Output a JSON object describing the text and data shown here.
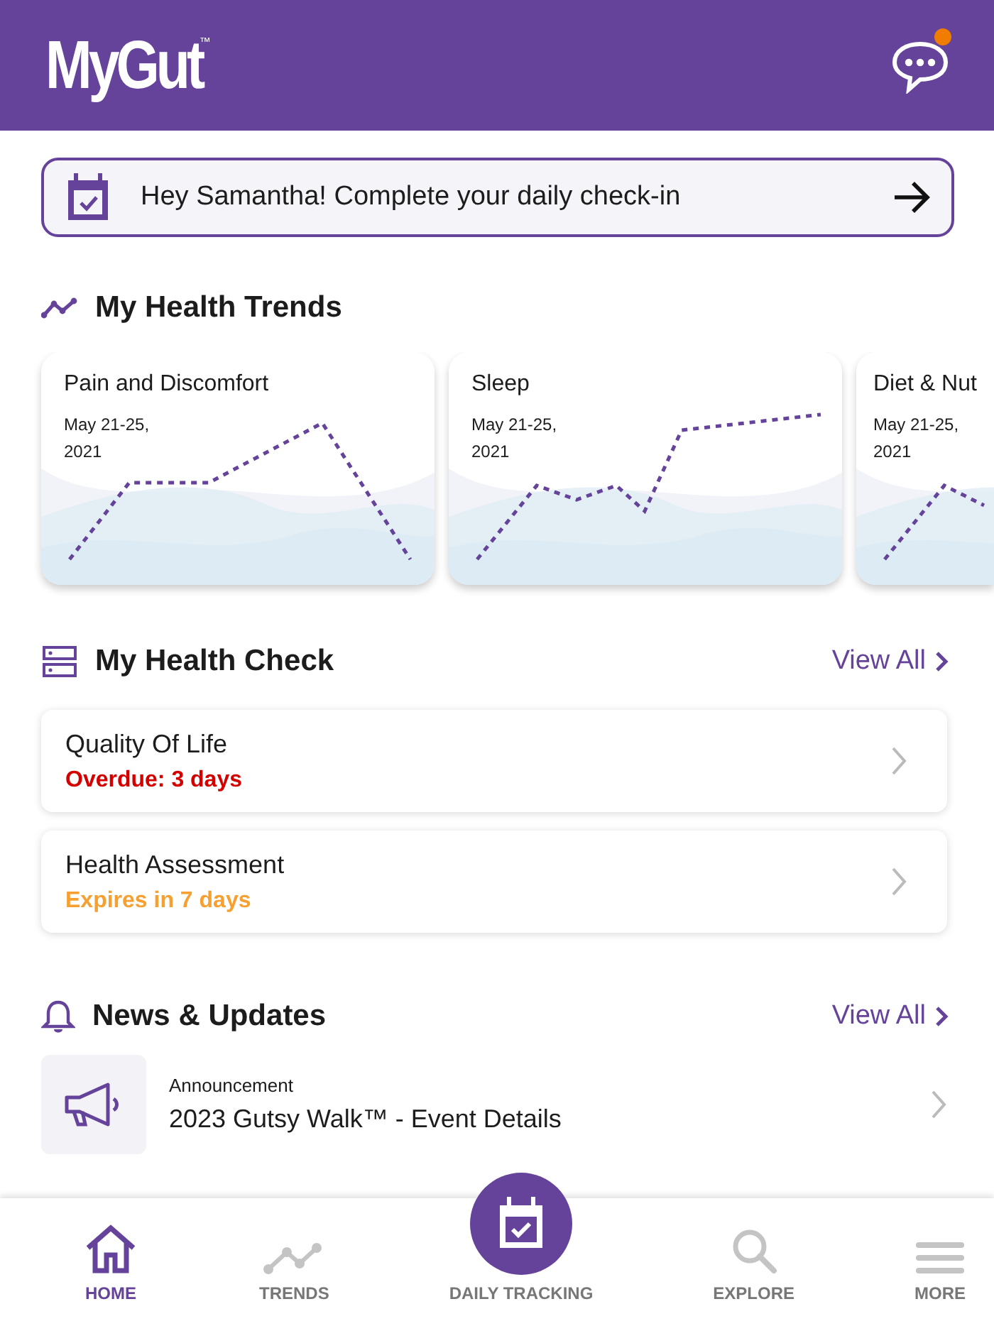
{
  "header": {
    "logo": "MyGut",
    "trademark": "™",
    "has_unread": true
  },
  "checkin_banner": {
    "text": "Hey Samantha! Complete your daily check-in"
  },
  "health_trends": {
    "title": "My Health Trends",
    "cards": [
      {
        "title": "Pain and Discomfort",
        "date_line_1": "May 21-25,",
        "date_line_2": "2021"
      },
      {
        "title": "Sleep",
        "date_line_1": "May 21-25,",
        "date_line_2": "2021"
      },
      {
        "title": "Diet & Nut",
        "date_line_1": "May 21-25,",
        "date_line_2": "2021"
      }
    ]
  },
  "health_check": {
    "title": "My Health Check",
    "view_all": "View All",
    "items": [
      {
        "title": "Quality Of Life",
        "status": "Overdue: 3 days",
        "kind": "overdue"
      },
      {
        "title": "Health Assessment",
        "status": "Expires in 7 days",
        "kind": "expiring"
      }
    ]
  },
  "news": {
    "title": "News & Updates",
    "view_all": "View All",
    "items": [
      {
        "category": "Announcement",
        "title": "2023 Gutsy Walk™ - Event Details"
      }
    ]
  },
  "bottom_nav": [
    {
      "label": "HOME",
      "selected": true
    },
    {
      "label": "TRENDS",
      "selected": false
    },
    {
      "label": "DAILY TRACKING",
      "selected": false
    },
    {
      "label": "EXPLORE",
      "selected": false
    },
    {
      "label": "MORE",
      "selected": false
    }
  ]
}
